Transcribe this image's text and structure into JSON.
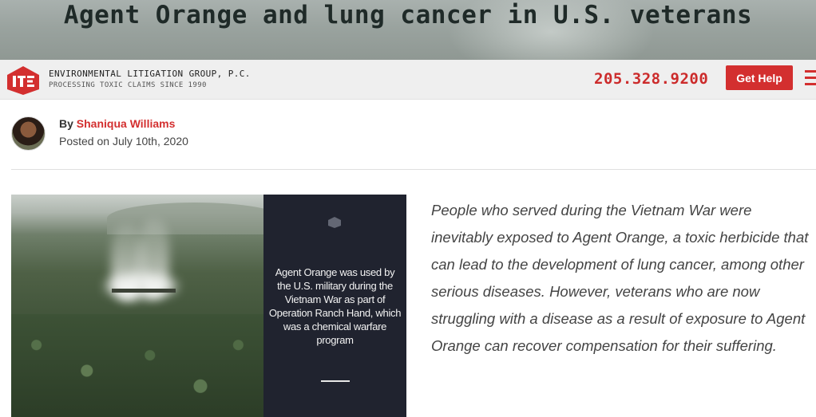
{
  "hero": {
    "title": "Agent Orange and lung cancer in U.S. veterans"
  },
  "header": {
    "brand_name": "ENVIRONMENTAL LITIGATION GROUP, P.C.",
    "brand_tagline": "PROCESSING TOXIC CLAIMS SINCE 1990",
    "phone": "205.328.9200",
    "cta_label": "Get Help",
    "accent_color": "#d32f2f"
  },
  "author": {
    "by_prefix": "By ",
    "name": "Shaniqua Williams",
    "posted": "Posted on July 10th, 2020"
  },
  "figure": {
    "caption": "Agent Orange was used by the U.S. military during the Vietnam War as part of Operation Ranch Hand, which was a chemical warfare program"
  },
  "article": {
    "intro": "People who served during the Vietnam War were inevitably exposed to Agent Orange, a toxic herbicide that can lead to the development of lung cancer, among other serious diseases. However, veterans who are now struggling with a disease as a result of exposure to Agent Orange can recover compensation for their suffering."
  }
}
